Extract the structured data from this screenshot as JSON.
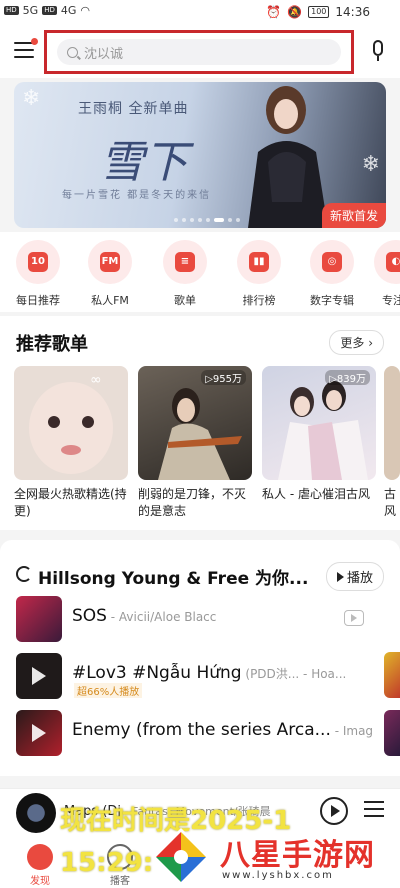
{
  "status_bar": {
    "left_tags": [
      "HD",
      "HD"
    ],
    "network": [
      "5G",
      "4G"
    ],
    "battery": "100",
    "time": "14:36"
  },
  "search": {
    "placeholder": "沈以诚"
  },
  "banner": {
    "artist_line": "王雨桐  全新单曲",
    "song_calligraphy": "雪下",
    "tagline": "每一片雪花  都是冬天的来信",
    "badge": "新歌首发"
  },
  "quick_icons": [
    {
      "label": "每日推荐",
      "glyph": "10",
      "icon": "calendar-icon"
    },
    {
      "label": "私人FM",
      "glyph": "FM",
      "icon": "radio-icon"
    },
    {
      "label": "歌单",
      "glyph": "≡",
      "icon": "playlist-icon"
    },
    {
      "label": "排行榜",
      "glyph": "▮▮",
      "icon": "chart-icon"
    },
    {
      "label": "数字专辑",
      "glyph": "◎",
      "icon": "album-icon"
    },
    {
      "label": "专注",
      "glyph": "◐",
      "icon": "focus-icon"
    }
  ],
  "playlists": {
    "title": "推荐歌单",
    "more_label": "更多 ›",
    "items": [
      {
        "name": "全网最火热歌精选(持更)",
        "count": ""
      },
      {
        "name": "削弱的是刀锋，不灭的是意志",
        "count": "955万"
      },
      {
        "name": "私人 - 虐心催泪古风",
        "count": "839万"
      },
      {
        "name": "古风的",
        "count": ""
      }
    ]
  },
  "songs": {
    "title": "Hillsong Young & Free 为你...",
    "play_all_label": "播放",
    "items": [
      {
        "name": "SOS",
        "artist": " - Avicii/Aloe Blacc",
        "tag": ""
      },
      {
        "name": "#Lov3 #Ngẫu Hứng",
        "artist": " (PDD洪... - Hoa...",
        "tag": "超66%人播放"
      },
      {
        "name": "Enemy (from the series Arca...",
        "artist": " - Imag...",
        "tag": ""
      }
    ]
  },
  "mini_player": {
    "title": "Maps (Dj",
    "subtitle": " - Fantast Movement/张琦晨"
  },
  "tabs": [
    {
      "label": "发现",
      "active": true
    },
    {
      "label": "播客",
      "active": false
    }
  ],
  "overlay": {
    "line1": "现在时间是2025-1",
    "line2": "15:29:"
  },
  "watermark": {
    "text": "八星手游网",
    "url": "www.lyshbx.com"
  },
  "colors": {
    "accent": "#e94a3f",
    "search_highlight": "#c8282c"
  }
}
